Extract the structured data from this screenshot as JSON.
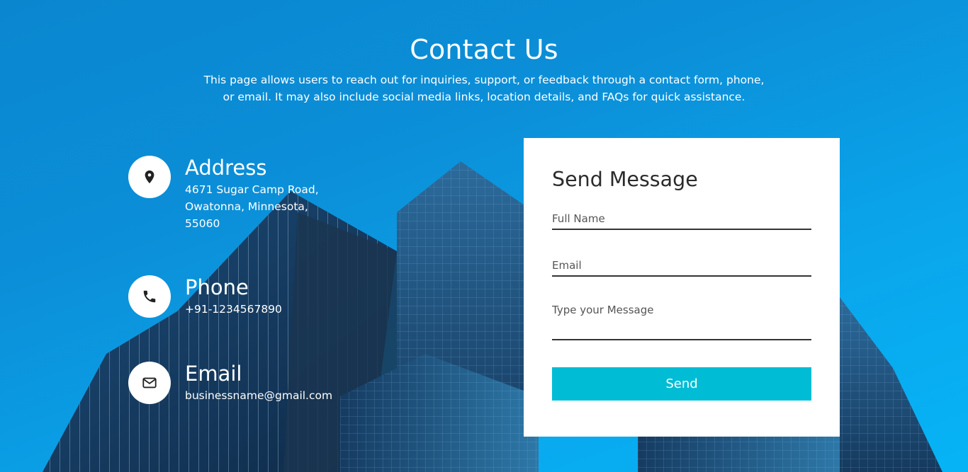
{
  "header": {
    "title": "Contact Us",
    "description": "This page allows users to reach out for inquiries, support, or feedback through a contact form, phone, or email. It may also include social media links, location details, and FAQs for quick assistance."
  },
  "contact_info": {
    "address": {
      "icon": "map-pin-icon",
      "title": "Address",
      "value": "4671 Sugar Camp Road, Owatonna, Minnesota, 55060"
    },
    "phone": {
      "icon": "phone-icon",
      "title": "Phone",
      "value": "+91-1234567890"
    },
    "email": {
      "icon": "envelope-icon",
      "title": "Email",
      "value": "businessname@gmail.com"
    }
  },
  "form": {
    "title": "Send Message",
    "full_name_placeholder": "Full Name",
    "email_placeholder": "Email",
    "message_placeholder": "Type your Message",
    "send_label": "Send"
  },
  "colors": {
    "background": "#0a8fd8",
    "button": "#00bcd4",
    "card": "#ffffff",
    "text_dark": "#333333"
  }
}
